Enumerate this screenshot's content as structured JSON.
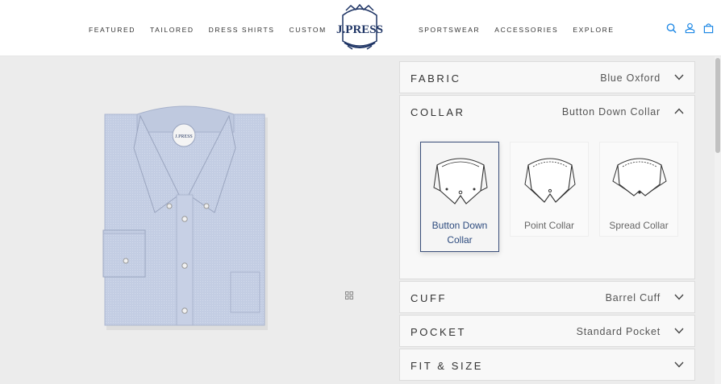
{
  "header": {
    "nav_left": [
      "FEATURED",
      "TAILORED",
      "DRESS SHIRTS",
      "CUSTOM"
    ],
    "nav_right": [
      "SPORTSWEAR",
      "ACCESSORIES",
      "EXPLORE"
    ],
    "logo_text": "J.PRESS",
    "icons": [
      "search-icon",
      "account-icon",
      "bag-icon"
    ],
    "accent_color": "#1e88e5"
  },
  "product": {
    "image": "blue oxford button-down dress shirt, folded",
    "label_text": "J.PRESS"
  },
  "config": {
    "sections": [
      {
        "title": "FABRIC",
        "value": "Blue Oxford",
        "expanded": false
      },
      {
        "title": "COLLAR",
        "value": "Button Down Collar",
        "expanded": true
      },
      {
        "title": "CUFF",
        "value": "Barrel Cuff",
        "expanded": false
      },
      {
        "title": "POCKET",
        "value": "Standard Pocket",
        "expanded": false
      },
      {
        "title": "FIT & SIZE",
        "value": "",
        "expanded": false
      }
    ],
    "collar_options": [
      {
        "label_line1": "Button Down",
        "label_line2": "Collar",
        "selected": true
      },
      {
        "label_line1": "Point Collar",
        "label_line2": "",
        "selected": false
      },
      {
        "label_line1": "Spread Collar",
        "label_line2": "",
        "selected": false
      }
    ],
    "selected_border_color": "#3b4f7a"
  }
}
